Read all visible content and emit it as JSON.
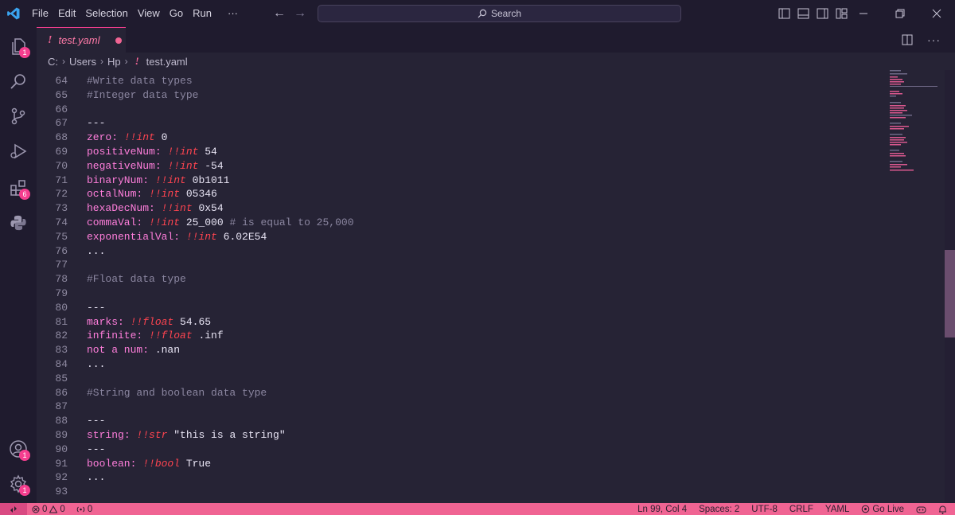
{
  "menu": [
    "File",
    "Edit",
    "Selection",
    "View",
    "Go",
    "Run",
    "···"
  ],
  "search": {
    "label": "Search"
  },
  "activity": {
    "explorer_badge": "1",
    "extensions_badge": "6",
    "accounts_badge": "1",
    "settings_badge": "1"
  },
  "tab": {
    "label": "test.yaml",
    "icon": "!"
  },
  "breadcrumb": {
    "parts": [
      "C:",
      "Users",
      "Hp"
    ],
    "file_icon": "!",
    "file": "test.yaml"
  },
  "code_lines": [
    {
      "n": "64",
      "tokens": [
        [
          "comment",
          "#Write data types"
        ]
      ]
    },
    {
      "n": "65",
      "tokens": [
        [
          "comment",
          "#Integer data type"
        ]
      ]
    },
    {
      "n": "66",
      "tokens": []
    },
    {
      "n": "67",
      "tokens": [
        [
          "plain",
          "---"
        ]
      ]
    },
    {
      "n": "68",
      "tokens": [
        [
          "key",
          "zero"
        ],
        [
          "sep",
          ": "
        ],
        [
          "tag",
          "!!int"
        ],
        [
          "val",
          " 0"
        ]
      ]
    },
    {
      "n": "69",
      "tokens": [
        [
          "key",
          "positiveNum"
        ],
        [
          "sep",
          ": "
        ],
        [
          "tag",
          "!!int"
        ],
        [
          "val",
          " 54"
        ]
      ]
    },
    {
      "n": "70",
      "tokens": [
        [
          "key",
          "negativeNum"
        ],
        [
          "sep",
          ": "
        ],
        [
          "tag",
          "!!int"
        ],
        [
          "val",
          " -54"
        ]
      ]
    },
    {
      "n": "71",
      "tokens": [
        [
          "key",
          "binaryNum"
        ],
        [
          "sep",
          ": "
        ],
        [
          "tag",
          "!!int"
        ],
        [
          "val",
          " 0b1011"
        ]
      ]
    },
    {
      "n": "72",
      "tokens": [
        [
          "key",
          "octalNum"
        ],
        [
          "sep",
          ": "
        ],
        [
          "tag",
          "!!int"
        ],
        [
          "val",
          " 05346"
        ]
      ]
    },
    {
      "n": "73",
      "tokens": [
        [
          "key",
          "hexaDecNum"
        ],
        [
          "sep",
          ": "
        ],
        [
          "tag",
          "!!int"
        ],
        [
          "val",
          " 0x54"
        ]
      ]
    },
    {
      "n": "74",
      "tokens": [
        [
          "key",
          "commaVal"
        ],
        [
          "sep",
          ": "
        ],
        [
          "tag",
          "!!int"
        ],
        [
          "val",
          " 25_000 "
        ],
        [
          "comment",
          "# is equal to 25,000"
        ]
      ]
    },
    {
      "n": "75",
      "tokens": [
        [
          "key",
          "exponentialVal"
        ],
        [
          "sep",
          ": "
        ],
        [
          "tag",
          "!!int"
        ],
        [
          "val",
          " 6.02E54"
        ]
      ]
    },
    {
      "n": "76",
      "tokens": [
        [
          "plain",
          "..."
        ]
      ]
    },
    {
      "n": "77",
      "tokens": []
    },
    {
      "n": "78",
      "tokens": [
        [
          "comment",
          "#Float data type"
        ]
      ]
    },
    {
      "n": "79",
      "tokens": []
    },
    {
      "n": "80",
      "tokens": [
        [
          "plain",
          "---"
        ]
      ]
    },
    {
      "n": "81",
      "tokens": [
        [
          "key",
          "marks"
        ],
        [
          "sep",
          ": "
        ],
        [
          "tag",
          "!!float"
        ],
        [
          "val",
          " 54.65"
        ]
      ]
    },
    {
      "n": "82",
      "tokens": [
        [
          "key",
          "infinite"
        ],
        [
          "sep",
          ": "
        ],
        [
          "tag",
          "!!float"
        ],
        [
          "val",
          " .inf"
        ]
      ]
    },
    {
      "n": "83",
      "tokens": [
        [
          "key",
          "not a num"
        ],
        [
          "sep",
          ": "
        ],
        [
          "val",
          ".nan"
        ]
      ]
    },
    {
      "n": "84",
      "tokens": [
        [
          "plain",
          "..."
        ]
      ]
    },
    {
      "n": "85",
      "tokens": []
    },
    {
      "n": "86",
      "tokens": [
        [
          "comment",
          "#String and boolean data type"
        ]
      ]
    },
    {
      "n": "87",
      "tokens": []
    },
    {
      "n": "88",
      "tokens": [
        [
          "plain",
          "---"
        ]
      ]
    },
    {
      "n": "89",
      "tokens": [
        [
          "key",
          "string"
        ],
        [
          "sep",
          ": "
        ],
        [
          "tag",
          "!!str"
        ],
        [
          "val",
          " \"this is a string\""
        ]
      ]
    },
    {
      "n": "90",
      "tokens": [
        [
          "plain",
          "---"
        ]
      ]
    },
    {
      "n": "91",
      "tokens": [
        [
          "key",
          "boolean"
        ],
        [
          "sep",
          ": "
        ],
        [
          "tag",
          "!!bool"
        ],
        [
          "val",
          " True"
        ]
      ]
    },
    {
      "n": "92",
      "tokens": [
        [
          "plain",
          "..."
        ]
      ]
    },
    {
      "n": "93",
      "tokens": []
    }
  ],
  "status": {
    "errors": "0",
    "warnings": "0",
    "ports": "0",
    "position": "Ln 99, Col 4",
    "spaces": "Spaces: 2",
    "encoding": "UTF-8",
    "eol": "CRLF",
    "language": "YAML",
    "golive": "Go Live"
  },
  "colors": {
    "accent": "#f06493",
    "editor_bg": "#262335",
    "chrome_bg": "#1f1b2e"
  }
}
